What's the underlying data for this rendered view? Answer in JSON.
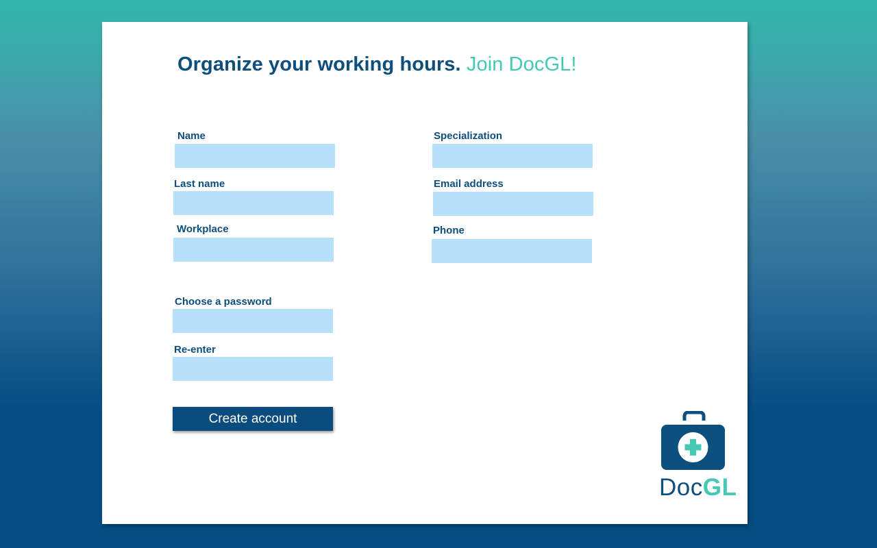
{
  "headline": {
    "main": "Organize your working hours.",
    "accent": "Join DocGL!"
  },
  "form": {
    "name_label": "Name",
    "last_name_label": "Last name",
    "workplace_label": "Workplace",
    "specialization_label": "Specialization",
    "email_label": "Email address",
    "phone_label": "Phone",
    "password_label": "Choose a password",
    "reenter_label": "Re-enter",
    "name_value": "",
    "last_name_value": "",
    "workplace_value": "",
    "specialization_value": "",
    "email_value": "",
    "phone_value": "",
    "password_value": "",
    "reenter_value": ""
  },
  "actions": {
    "create_account_label": "Create account"
  },
  "logo": {
    "text_doc": "Doc",
    "text_gl": "GL",
    "icon": "medical-kit-icon"
  },
  "colors": {
    "primary": "#0e4e7c",
    "accent": "#44c9b4",
    "input_fill": "#b7e0fb",
    "button": "#0b4c7e"
  }
}
